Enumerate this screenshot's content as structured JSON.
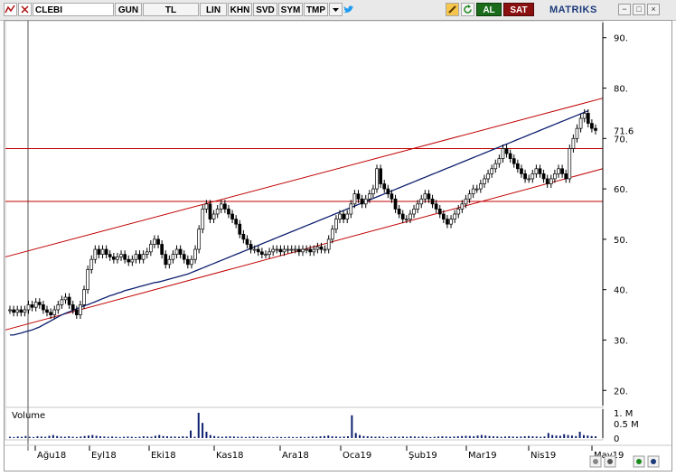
{
  "toolbar": {
    "symbol": "CLEBI",
    "period": "GUN",
    "currency": "TL",
    "scale": "LIN",
    "buttons": [
      "KHN",
      "SVD",
      "SYM",
      "TMP"
    ],
    "buy_label": "AL",
    "sell_label": "SAT",
    "brand": "MATRIKS",
    "buy_color": "#1a6b1a",
    "sell_color": "#8b1010"
  },
  "chart_data": {
    "type": "line",
    "title": "",
    "y_ticks": [
      20,
      30,
      40,
      50,
      60,
      70,
      80,
      90
    ],
    "ylim": [
      17,
      93
    ],
    "last_price_label": "71.6",
    "x_labels": [
      "Ağu18",
      "Eyl18",
      "Eki18",
      "Kas18",
      "Ara18",
      "Oca19",
      "Şub19",
      "Mar19",
      "Nis19",
      "May19"
    ],
    "series": [
      {
        "values": [
          36,
          35.5,
          36,
          35.5,
          36,
          37,
          36.5,
          37.5,
          37,
          36,
          35.5,
          35,
          36,
          37,
          38,
          38.5,
          37,
          36,
          35,
          37,
          40,
          44,
          46,
          48,
          47,
          48,
          47,
          46.5,
          46,
          46.5,
          47,
          46,
          45.5,
          46,
          47,
          46,
          47,
          47.5,
          49,
          50,
          49,
          47,
          45,
          46,
          47,
          48,
          47,
          46,
          45,
          46,
          48,
          52,
          56,
          57,
          54,
          55,
          56,
          57,
          56,
          55,
          54,
          53,
          51,
          50,
          49,
          48,
          48,
          47.5,
          47,
          47,
          47.5,
          48,
          48,
          47.5,
          48,
          48,
          48,
          48,
          47.5,
          48,
          48,
          47.5,
          48,
          48.5,
          48,
          48,
          50,
          52,
          54,
          55,
          54,
          55,
          57,
          59,
          58,
          57,
          58,
          59,
          60,
          64,
          61,
          60,
          59,
          58,
          56,
          55,
          54,
          54,
          55,
          56,
          57,
          58,
          59,
          58,
          57,
          56,
          55,
          54,
          53,
          54,
          55,
          56,
          57,
          58,
          59,
          60,
          60,
          61,
          62,
          63,
          64,
          65,
          66,
          68,
          67,
          66,
          65,
          64,
          63,
          62,
          62,
          63,
          64,
          63,
          62,
          61,
          62,
          63,
          64,
          63,
          62,
          68,
          70,
          72,
          74,
          75,
          73,
          72,
          71.6
        ]
      },
      {
        "values": [
          31,
          31,
          31.2,
          31.4,
          31.6,
          31.8,
          32,
          32.3,
          32.6,
          33,
          33.4,
          33.8,
          34.2,
          34.6,
          35,
          35.3,
          35.6,
          35.9,
          36.2,
          36.5,
          36.8,
          37,
          37.3,
          37.6,
          37.9,
          38.2,
          38.5,
          38.8,
          39,
          39.3,
          39.5,
          39.8,
          40,
          40.2,
          40.4,
          40.6,
          40.8,
          41,
          41.2,
          41.4,
          41.5,
          41.7,
          41.9,
          42.1,
          42.3,
          42.5,
          42.7,
          42.9,
          43.1,
          43.4,
          43.7,
          44,
          44.3,
          44.6,
          44.9,
          45.2,
          45.5,
          45.8,
          46.1,
          46.4,
          46.7,
          47,
          47.3,
          47.6,
          47.9,
          48.2,
          48.5,
          48.8,
          49.1,
          49.4,
          49.7,
          50,
          50.3,
          50.6,
          50.9,
          51.2,
          51.5,
          51.8,
          52.1,
          52.4,
          52.7,
          53,
          53.3,
          53.6,
          53.9,
          54.2,
          54.5,
          54.8,
          55.1,
          55.4,
          55.7,
          56,
          56.3,
          56.6,
          56.9,
          57.2,
          57.5,
          57.8,
          58.1,
          58.4,
          58.7,
          59,
          59.3,
          59.6,
          59.9,
          60.2,
          60.5,
          60.8,
          61.1,
          61.4,
          61.7,
          62,
          62.3,
          62.6,
          62.9,
          63.2,
          63.5,
          63.8,
          64.1,
          64.4,
          64.7,
          65,
          65.3,
          65.6,
          65.9,
          66.2,
          66.5,
          66.8,
          67.1,
          67.4,
          67.7,
          68,
          68.3,
          68.6,
          68.9,
          69.2,
          69.5,
          69.8,
          70.1,
          70.4,
          70.7,
          71,
          71.3,
          71.6,
          71.9,
          72.2,
          72.5,
          72.8,
          73.1,
          73.4,
          73.7,
          74,
          74.3,
          74.6,
          74.9,
          75.2,
          75.5
        ]
      }
    ],
    "horizontal_lines": [
      68,
      57.5
    ],
    "channel_upper": [
      [
        0,
        46.5
      ],
      [
        1,
        78
      ]
    ],
    "channel_lower": [
      [
        0,
        32
      ],
      [
        1,
        64
      ]
    ],
    "volume": {
      "label": "Volume",
      "ticks": [
        "1. M",
        "0.5 M",
        "0"
      ],
      "values": [
        0.05,
        0.04,
        0.06,
        0.05,
        0.08,
        0.05,
        0.04,
        0.07,
        0.06,
        0.05,
        0.09,
        0.12,
        0.08,
        0.06,
        0.05,
        0.07,
        0.05,
        0.04,
        0.06,
        0.08,
        0.1,
        0.12,
        0.09,
        0.07,
        0.06,
        0.05,
        0.06,
        0.05,
        0.04,
        0.05,
        0.06,
        0.05,
        0.04,
        0.05,
        0.07,
        0.06,
        0.05,
        0.09,
        0.12,
        0.08,
        0.07,
        0.06,
        0.06,
        0.05,
        0.07,
        0.06,
        0.3,
        0.05,
        1.0,
        0.6,
        0.25,
        0.12,
        0.08,
        0.06,
        0.05,
        0.06,
        0.07,
        0.06,
        0.05,
        0.05,
        0.04,
        0.05,
        0.06,
        0.05,
        0.05,
        0.04,
        0.05,
        0.04,
        0.05,
        0.04,
        0.04,
        0.05,
        0.04,
        0.04,
        0.05,
        0.04,
        0.05,
        0.06,
        0.05,
        0.07,
        0.08,
        0.1,
        0.07,
        0.06,
        0.05,
        0.06,
        0.07,
        0.9,
        0.2,
        0.12,
        0.08,
        0.07,
        0.06,
        0.05,
        0.06,
        0.05,
        0.04,
        0.05,
        0.06,
        0.05,
        0.06,
        0.05,
        0.07,
        0.06,
        0.05,
        0.06,
        0.05,
        0.04,
        0.05,
        0.06,
        0.07,
        0.06,
        0.05,
        0.06,
        0.07,
        0.08,
        0.09,
        0.08,
        0.07,
        0.1,
        0.12,
        0.1,
        0.08,
        0.07,
        0.06,
        0.05,
        0.06,
        0.07,
        0.06,
        0.05,
        0.06,
        0.07,
        0.08,
        0.07,
        0.06,
        0.05,
        0.06,
        0.2,
        0.12,
        0.1,
        0.09,
        0.15,
        0.12,
        0.1,
        0.08,
        0.25,
        0.12,
        0.1,
        0.08,
        0.07
      ]
    }
  }
}
